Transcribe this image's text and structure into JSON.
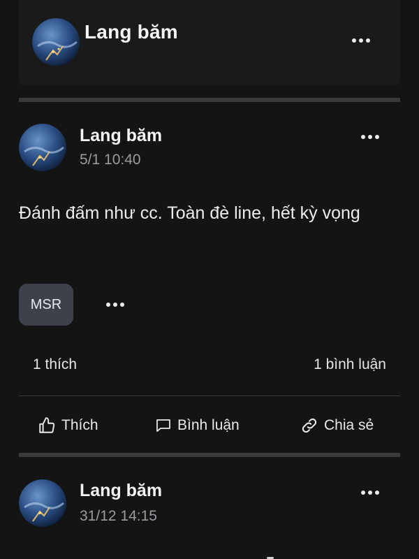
{
  "header": {
    "name": "Lang băm",
    "more_icon": "more-horizontal-icon"
  },
  "posts": [
    {
      "author": "Lang băm",
      "time": "5/1 10:40",
      "text": "Đánh đấm như cc. Toàn đè line, hết kỳ vọng",
      "tag": "MSR",
      "likes": "1 thích",
      "comments": "1 bình luận"
    },
    {
      "author": "Lang băm",
      "time": "31/12 14:15"
    }
  ],
  "actions": {
    "like_label": "Thích",
    "comment_label": "Bình luận",
    "share_label": "Chia sẻ"
  },
  "colors": {
    "background": "#141414",
    "card": "#1a1a1a",
    "divider": "#3a3a3a",
    "chip": "#3d4149",
    "muted_text": "#9a9aa0"
  }
}
